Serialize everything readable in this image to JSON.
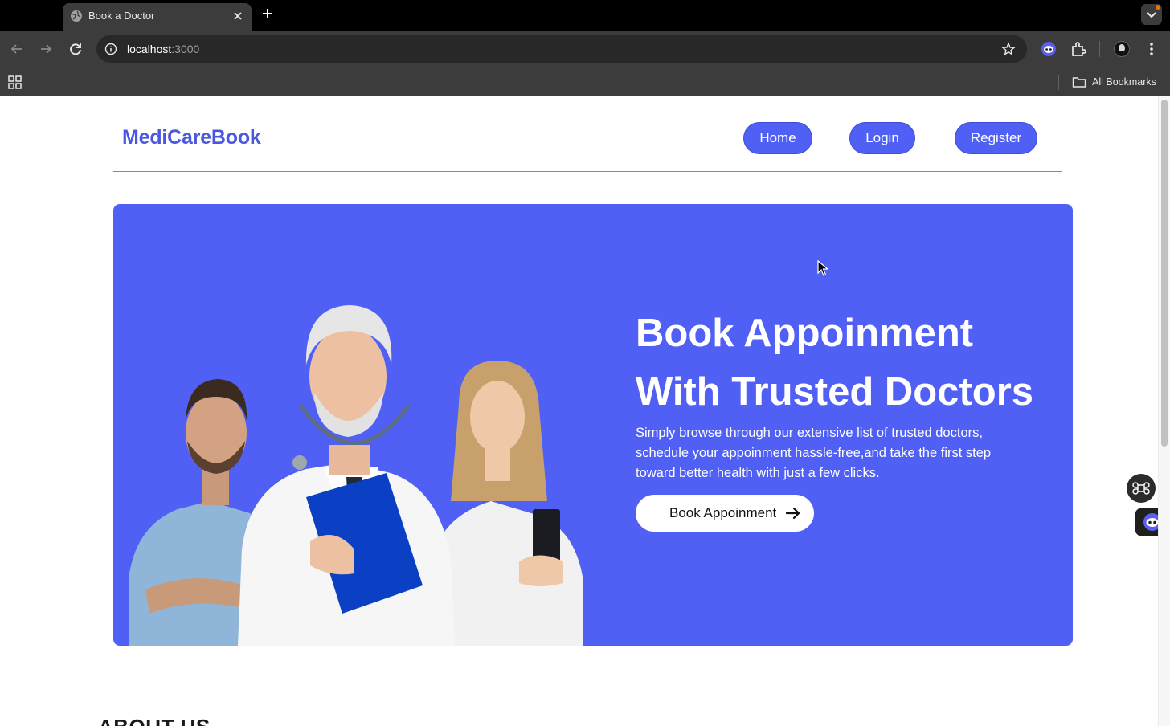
{
  "browser": {
    "tab_title": "Book a Doctor",
    "url_host": "localhost",
    "url_port": ":3000",
    "bookmarks_label": "All Bookmarks",
    "icons": [
      "globe-icon",
      "close-icon",
      "plus-icon",
      "back-icon",
      "forward-icon",
      "reload-icon",
      "info-icon",
      "star-icon",
      "extension-icon",
      "profile-icon",
      "more-icon",
      "apps-icon",
      "folder-icon",
      "chevron-down-icon"
    ]
  },
  "site": {
    "logo": "MediCareBook",
    "nav": [
      {
        "label": "Home"
      },
      {
        "label": "Login"
      },
      {
        "label": "Register"
      }
    ]
  },
  "hero": {
    "title_line1": "Book Appoinment",
    "title_line2": "With Trusted Doctors",
    "subtitle": "Simply browse through our extensive list of trusted doctors, schedule your appoinment hassle-free,and take the first step toward better health with just a few clicks.",
    "cta_label": "Book Appoinment",
    "background_color": "#5060f5"
  },
  "about": {
    "heading": "ABOUT US"
  },
  "colors": {
    "accent": "#5060f5",
    "logo": "#4a57e0"
  }
}
